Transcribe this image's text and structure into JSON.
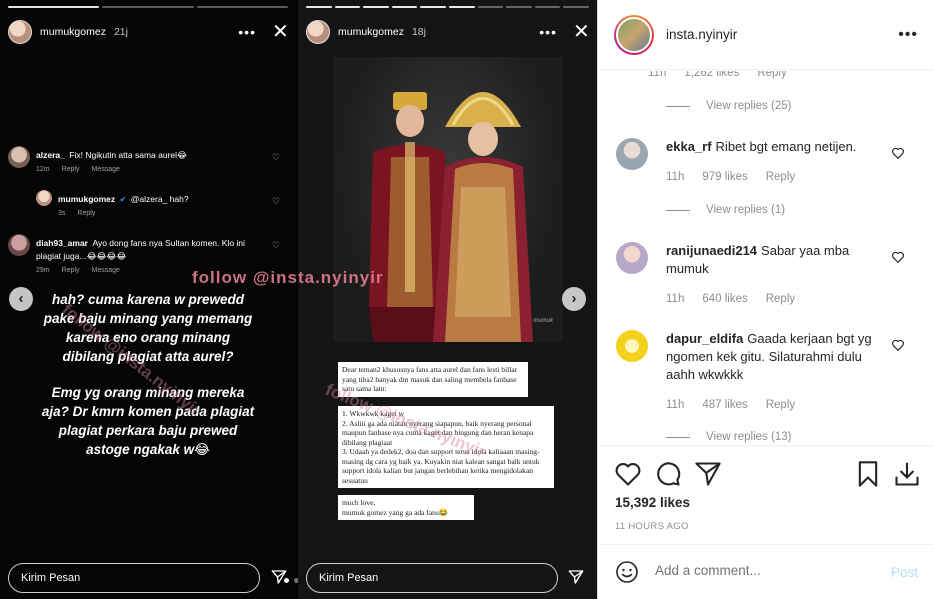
{
  "story_left": {
    "username": "mumukgomez",
    "time": "21j",
    "comments": [
      {
        "user": "alzera_",
        "text": "Fix! Ngikutin atta sama aurel😂",
        "age": "12m",
        "reply": "Reply",
        "message": "Message"
      },
      {
        "user": "mumukgomez",
        "text": "@alzera_ hah?",
        "age": "3s",
        "reply": "Reply"
      },
      {
        "user": "diah93_amar",
        "text": "Ayo dong fans nya Sultan komen. Klo ini plagiat juga...😂😂😂😂",
        "age": "29m",
        "reply": "Reply",
        "message": "Message"
      }
    ],
    "big_text": [
      "hah? cuma karena w prewedd pake baju minang yang memang karena eno orang minang dibilang plagiat atta aurel?",
      "Emg yg orang minang mereka aja? Dr kmrn komen pada plagiat plagiat perkara baju prewed astoge ngakak w😂"
    ],
    "reply_placeholder": "Kirim Pesan"
  },
  "story_right": {
    "username": "mumukgomez",
    "time": "18j",
    "note_1": "Dear teman2 khususnya fans atta aurel dan fans lesti billar yang tiba2 banyak dm masuk dan saling membela fanbase satu sama lain:",
    "note_2": "1. Wkwkwk kaget w\n2. Asliii ga ada niatan nyerang siapapun, baik nyerang personal maupun fanbase nya cuma kaget dan bingung dan heran kenapa dibilang plagiaat\n3. Udaah ya dedek2, doa dan support terus idola kaliaaan masing-masing dg cara yg baik ya. Kuyakin niat kalean sangat baik untuk support idola kalian but jangan berlebihan ketika mengidolakan sesuatuu",
    "note_3": "much love,\nmumuk gomez yang ga ada fans😂",
    "photo_signature": "mumuk",
    "reply_placeholder": "Kirim Pesan"
  },
  "watermark": "follow @insta.nyinyir",
  "watermark_faint": "follow @insta.nyinyir",
  "panel": {
    "username": "insta.nyinyir",
    "partial_meta": {
      "time": "11h",
      "likes": "1,262 likes",
      "reply": "Reply"
    },
    "partial_replies": "View replies (25)",
    "comments": [
      {
        "user": "ekka_rf",
        "text": "Ribet bgt emang netijen.",
        "time": "11h",
        "likes": "979 likes",
        "reply": "Reply",
        "replies": "View replies (1)",
        "avatar_color": "#9aa6b2"
      },
      {
        "user": "ranijunaedi214",
        "text": "Sabar yaa mba mumuk",
        "time": "11h",
        "likes": "640 likes",
        "reply": "Reply",
        "replies": "",
        "avatar_color": "#b7a7c9"
      },
      {
        "user": "dapur_eldifa",
        "text": "Gaada kerjaan bgt yg ngomen kek gitu. Silaturahmi dulu aahh wkwkkk",
        "time": "11h",
        "likes": "487 likes",
        "reply": "Reply",
        "replies": "View replies (13)",
        "avatar_color": "#f2d21b"
      }
    ],
    "likes_count": "15,392 likes",
    "time_ago": "11 HOURS AGO",
    "add_comment_placeholder": "Add a comment...",
    "post_label": "Post"
  }
}
